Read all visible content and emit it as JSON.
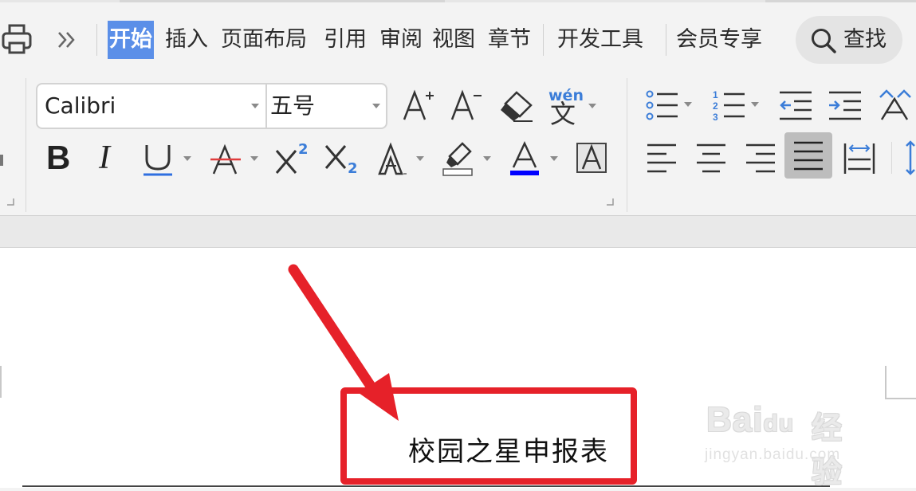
{
  "tabs": {
    "items": [
      {
        "label": "开始",
        "active": true
      },
      {
        "label": "插入"
      },
      {
        "label": "页面布局"
      },
      {
        "label": "引用"
      },
      {
        "label": "审阅"
      },
      {
        "label": "视图"
      },
      {
        "label": "章节"
      },
      {
        "label": "开发工具"
      },
      {
        "label": "会员专享"
      }
    ],
    "search_label": "查找",
    "more_icon": "double-chevron-right-icon",
    "print_icon": "print-icon"
  },
  "ribbon": {
    "font_name": "Calibri",
    "font_size": "五号",
    "pinyin_guide_text": "wén",
    "pinyin_guide_char": "文",
    "superscript_digit": "2",
    "subscript_digit": "2",
    "colors": {
      "accent": "#5b8fe8",
      "font_color_bar": "#0000ff",
      "underline": "#2f6fe0",
      "strike_line": "#e03c3c",
      "list_icon_blue": "#3b7dd8"
    }
  },
  "document": {
    "title_text": "校园之星申报表",
    "annotation_color": "#e62129"
  },
  "watermark": {
    "brand": "Bai",
    "brand_tail": "du",
    "cn": "经验",
    "url": "jingyan.baidu.com"
  }
}
